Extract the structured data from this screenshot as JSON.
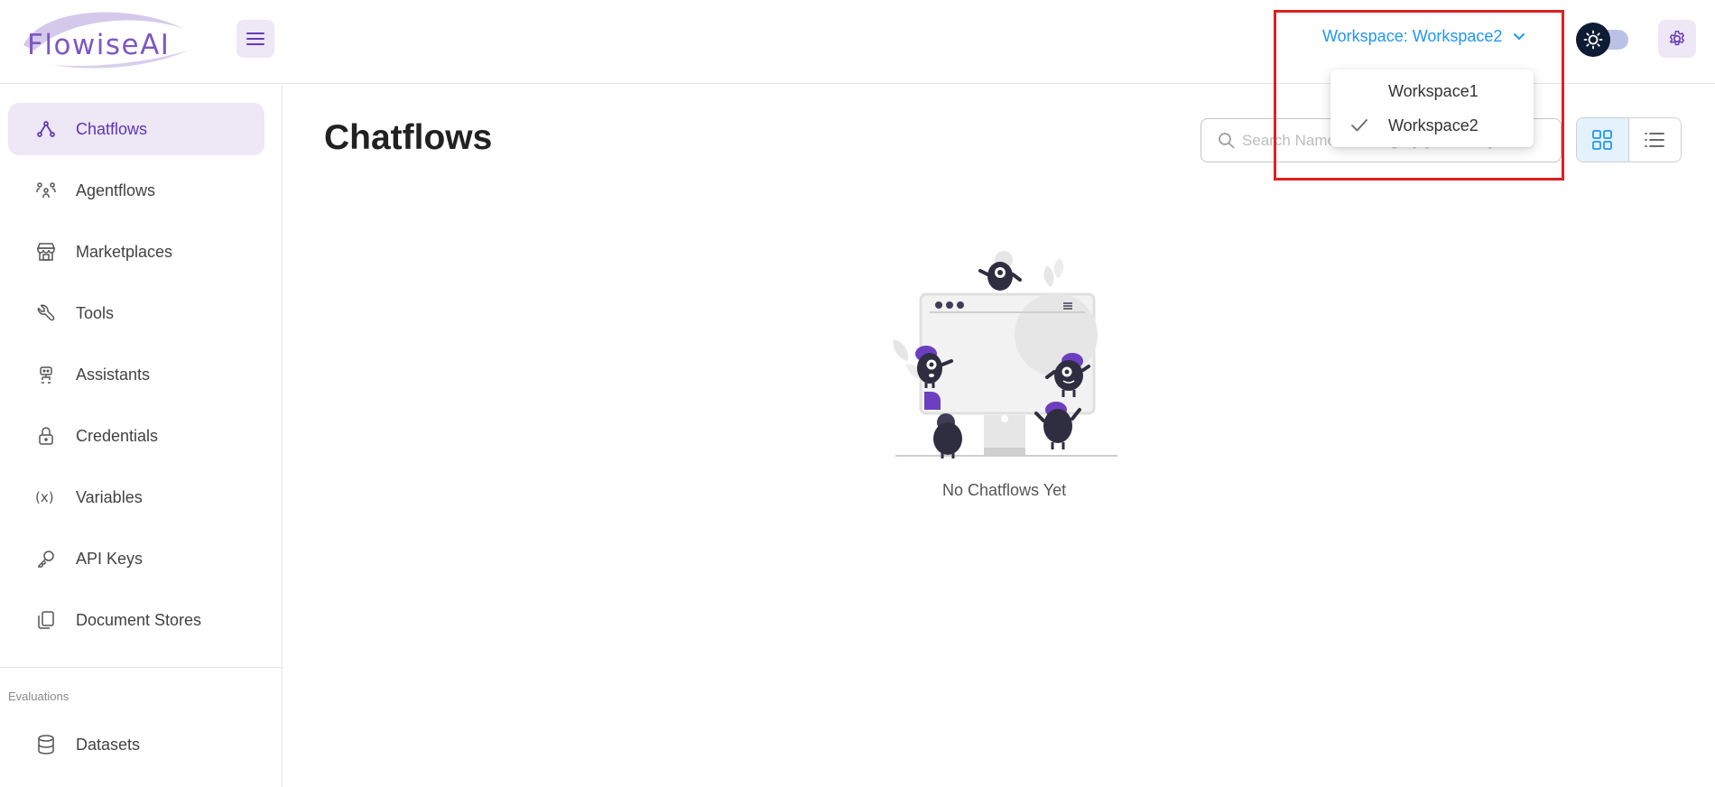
{
  "header": {
    "logo_text": "FlowiseAI",
    "workspace_selector_label": "Workspace: Workspace2"
  },
  "workspace_menu": {
    "options": [
      {
        "label": "Workspace1",
        "selected": false
      },
      {
        "label": "Workspace2",
        "selected": true
      }
    ]
  },
  "sidebar": {
    "items": [
      {
        "label": "Chatflows",
        "icon": "chatflows-icon",
        "active": true
      },
      {
        "label": "Agentflows",
        "icon": "agentflows-icon"
      },
      {
        "label": "Marketplaces",
        "icon": "marketplaces-icon"
      },
      {
        "label": "Tools",
        "icon": "tools-icon"
      },
      {
        "label": "Assistants",
        "icon": "assistants-icon"
      },
      {
        "label": "Credentials",
        "icon": "lock-icon"
      },
      {
        "label": "Variables",
        "icon": "variables-icon"
      },
      {
        "label": "API Keys",
        "icon": "key-icon"
      },
      {
        "label": "Document Stores",
        "icon": "document-stores-icon"
      }
    ],
    "section_label": "Evaluations",
    "section_items": [
      {
        "label": "Datasets",
        "icon": "datasets-icon"
      }
    ]
  },
  "main": {
    "title": "Chatflows",
    "search_placeholder": "Search Name or Category [ Ctrl + F ]",
    "empty_text": "No Chatflows Yet"
  },
  "colors": {
    "accent": "#5e35b1",
    "accent_light": "#ede7f6",
    "link_blue": "#2196f3",
    "highlight_red": "#e02020"
  }
}
